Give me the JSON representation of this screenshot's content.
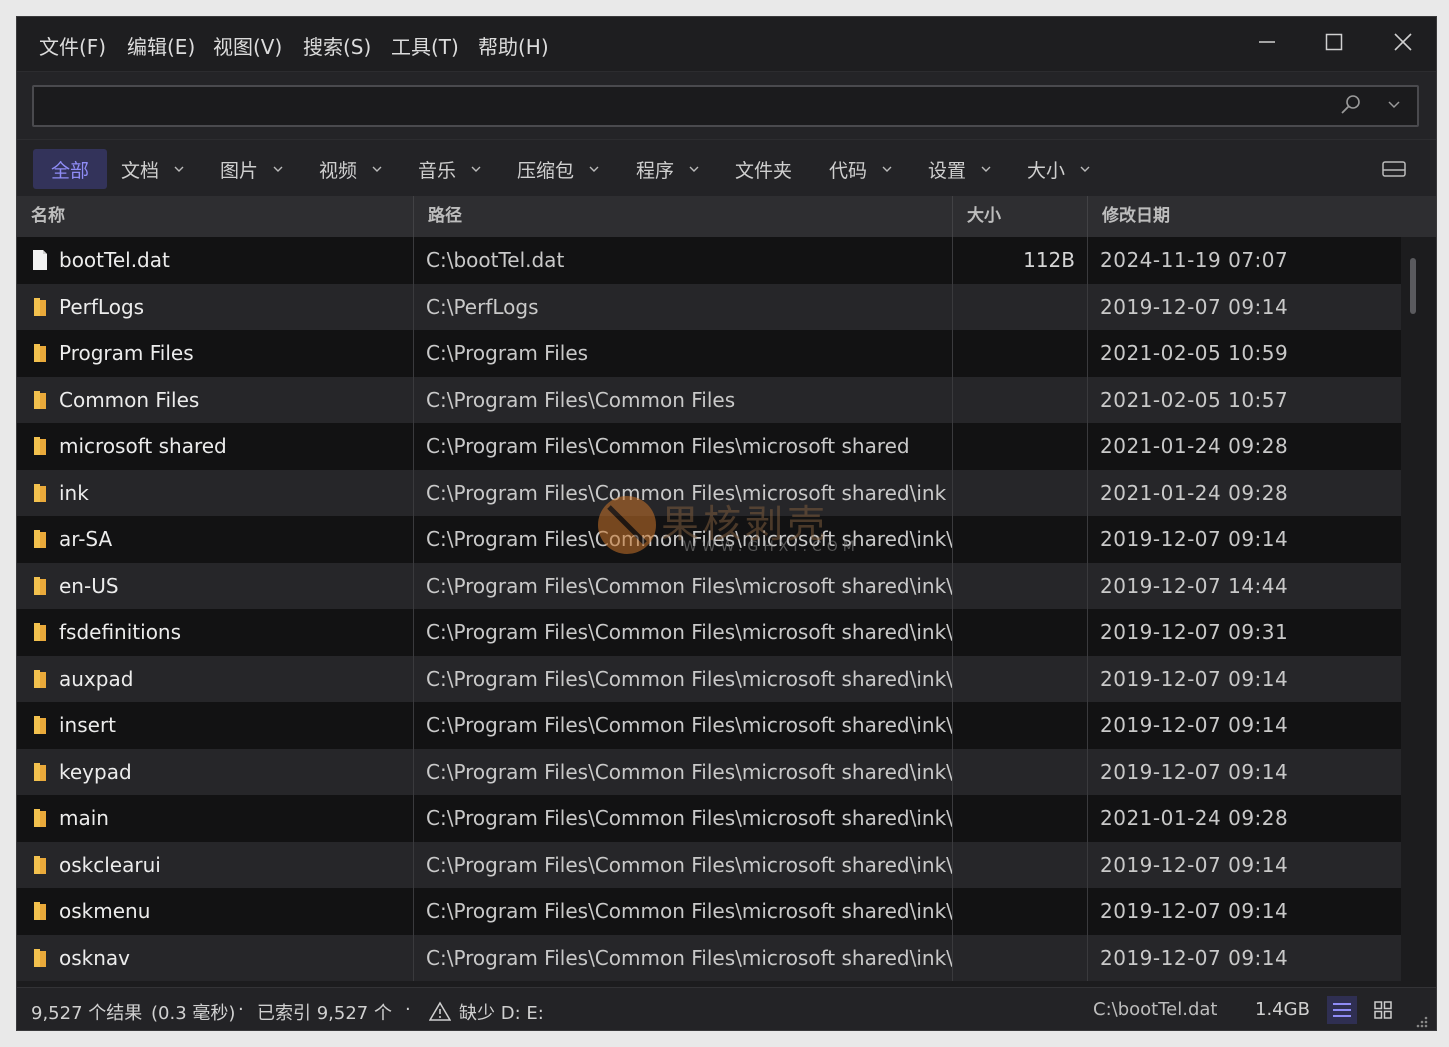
{
  "menu": [
    "文件(F)",
    "编辑(E)",
    "视图(V)",
    "搜索(S)",
    "工具(T)",
    "帮助(H)"
  ],
  "search": {
    "value": "",
    "placeholder": ""
  },
  "filters": [
    {
      "label": "全部",
      "dropdown": false,
      "active": true
    },
    {
      "label": "文档",
      "dropdown": true
    },
    {
      "label": "图片",
      "dropdown": true
    },
    {
      "label": "视频",
      "dropdown": true
    },
    {
      "label": "音乐",
      "dropdown": true
    },
    {
      "label": "压缩包",
      "dropdown": true
    },
    {
      "label": "程序",
      "dropdown": true
    },
    {
      "label": "文件夹",
      "dropdown": false
    },
    {
      "label": "代码",
      "dropdown": true
    },
    {
      "label": "设置",
      "dropdown": true
    },
    {
      "label": "大小",
      "dropdown": true
    }
  ],
  "columns": {
    "name": "名称",
    "path": "路径",
    "size": "大小",
    "date": "修改日期"
  },
  "rows": [
    {
      "type": "file",
      "name": "bootTel.dat",
      "path": "C:\\bootTel.dat",
      "size": "112B",
      "date": "2024-11-19 07:07"
    },
    {
      "type": "folder",
      "name": "PerfLogs",
      "path": "C:\\PerfLogs",
      "size": "",
      "date": "2019-12-07 09:14"
    },
    {
      "type": "folder",
      "name": "Program Files",
      "path": "C:\\Program Files",
      "size": "",
      "date": "2021-02-05 10:59"
    },
    {
      "type": "folder",
      "name": "Common Files",
      "path": "C:\\Program Files\\Common Files",
      "size": "",
      "date": "2021-02-05 10:57"
    },
    {
      "type": "folder",
      "name": "microsoft shared",
      "path": "C:\\Program Files\\Common Files\\microsoft shared",
      "size": "",
      "date": "2021-01-24 09:28"
    },
    {
      "type": "folder",
      "name": "ink",
      "path": "C:\\Program Files\\Common Files\\microsoft shared\\ink",
      "size": "",
      "date": "2021-01-24 09:28"
    },
    {
      "type": "folder",
      "name": "ar-SA",
      "path": "C:\\Program Files\\Common Files\\microsoft shared\\ink\\a...",
      "size": "",
      "date": "2019-12-07 09:14"
    },
    {
      "type": "folder",
      "name": "en-US",
      "path": "C:\\Program Files\\Common Files\\microsoft shared\\ink\\e...",
      "size": "",
      "date": "2019-12-07 14:44"
    },
    {
      "type": "folder",
      "name": "fsdefinitions",
      "path": "C:\\Program Files\\Common Files\\microsoft shared\\ink\\f...",
      "size": "",
      "date": "2019-12-07 09:31"
    },
    {
      "type": "folder",
      "name": "auxpad",
      "path": "C:\\Program Files\\Common Files\\microsoft shared\\ink\\f...",
      "size": "",
      "date": "2019-12-07 09:14"
    },
    {
      "type": "folder",
      "name": "insert",
      "path": "C:\\Program Files\\Common Files\\microsoft shared\\ink\\f...",
      "size": "",
      "date": "2019-12-07 09:14"
    },
    {
      "type": "folder",
      "name": "keypad",
      "path": "C:\\Program Files\\Common Files\\microsoft shared\\ink\\f...",
      "size": "",
      "date": "2019-12-07 09:14"
    },
    {
      "type": "folder",
      "name": "main",
      "path": "C:\\Program Files\\Common Files\\microsoft shared\\ink\\f...",
      "size": "",
      "date": "2021-01-24 09:28"
    },
    {
      "type": "folder",
      "name": "oskclearui",
      "path": "C:\\Program Files\\Common Files\\microsoft shared\\ink\\f...",
      "size": "",
      "date": "2019-12-07 09:14"
    },
    {
      "type": "folder",
      "name": "oskmenu",
      "path": "C:\\Program Files\\Common Files\\microsoft shared\\ink\\f...",
      "size": "",
      "date": "2019-12-07 09:14"
    },
    {
      "type": "folder",
      "name": "osknav",
      "path": "C:\\Program Files\\Common Files\\microsoft shared\\ink\\f...",
      "size": "",
      "date": "2019-12-07 09:14"
    }
  ],
  "watermark": {
    "text": "果核剥壳",
    "url": "WWW.GHXI.COM"
  },
  "status": {
    "results": "9,527 个结果",
    "time": "(0.3 毫秒)",
    "sep1": "·",
    "indexed": "已索引 9,527 个",
    "sep2": "·",
    "missing": "缺少 D: E:",
    "selected_path": "C:\\bootTel.dat",
    "disk": "1.4GB"
  },
  "colors": {
    "accent": "#8f8cf6",
    "folder": "#f2c14e",
    "background": "#1c1c1e"
  }
}
